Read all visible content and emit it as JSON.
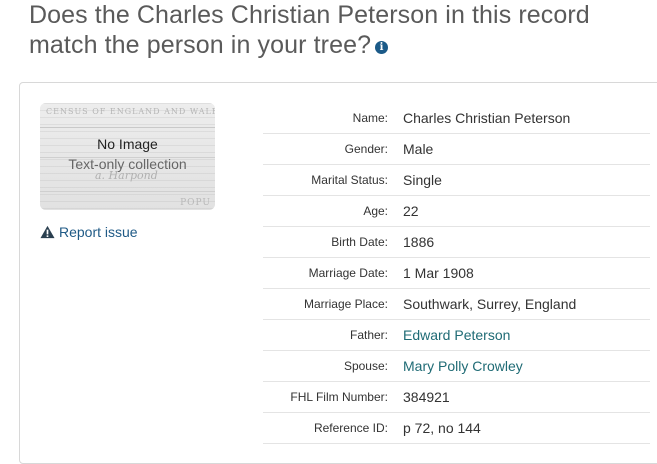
{
  "question": {
    "text": "Does the Charles Christian Peterson in this record match the person in your tree?",
    "info_icon": "info-icon"
  },
  "thumbnail": {
    "doc_header": "CENSUS OF ENGLAND AND WALES,",
    "doc_script": "a. Harpond",
    "doc_footer": "POPU",
    "no_image": "No Image",
    "collection_type": "Text-only collection"
  },
  "report_issue": {
    "label": "Report issue",
    "icon": "warning-icon"
  },
  "facts": [
    {
      "label": "Name:",
      "value": "Charles Christian Peterson",
      "link": false
    },
    {
      "label": "Gender:",
      "value": "Male",
      "link": false
    },
    {
      "label": "Marital Status:",
      "value": "Single",
      "link": false
    },
    {
      "label": "Age:",
      "value": "22",
      "link": false
    },
    {
      "label": "Birth Date:",
      "value": "1886",
      "link": false
    },
    {
      "label": "Marriage Date:",
      "value": "1 Mar 1908",
      "link": false
    },
    {
      "label": "Marriage Place:",
      "value": "Southwark, Surrey, England",
      "link": false
    },
    {
      "label": "Father:",
      "value": "Edward Peterson",
      "link": true
    },
    {
      "label": "Spouse:",
      "value": "Mary Polly Crowley",
      "link": true
    },
    {
      "label": "FHL Film Number:",
      "value": "384921",
      "link": false
    },
    {
      "label": "Reference ID:",
      "value": "p 72, no 144",
      "link": false
    }
  ],
  "colors": {
    "link": "#1f6b75",
    "report_link": "#1f5a86",
    "heading": "#5a5a5a"
  }
}
